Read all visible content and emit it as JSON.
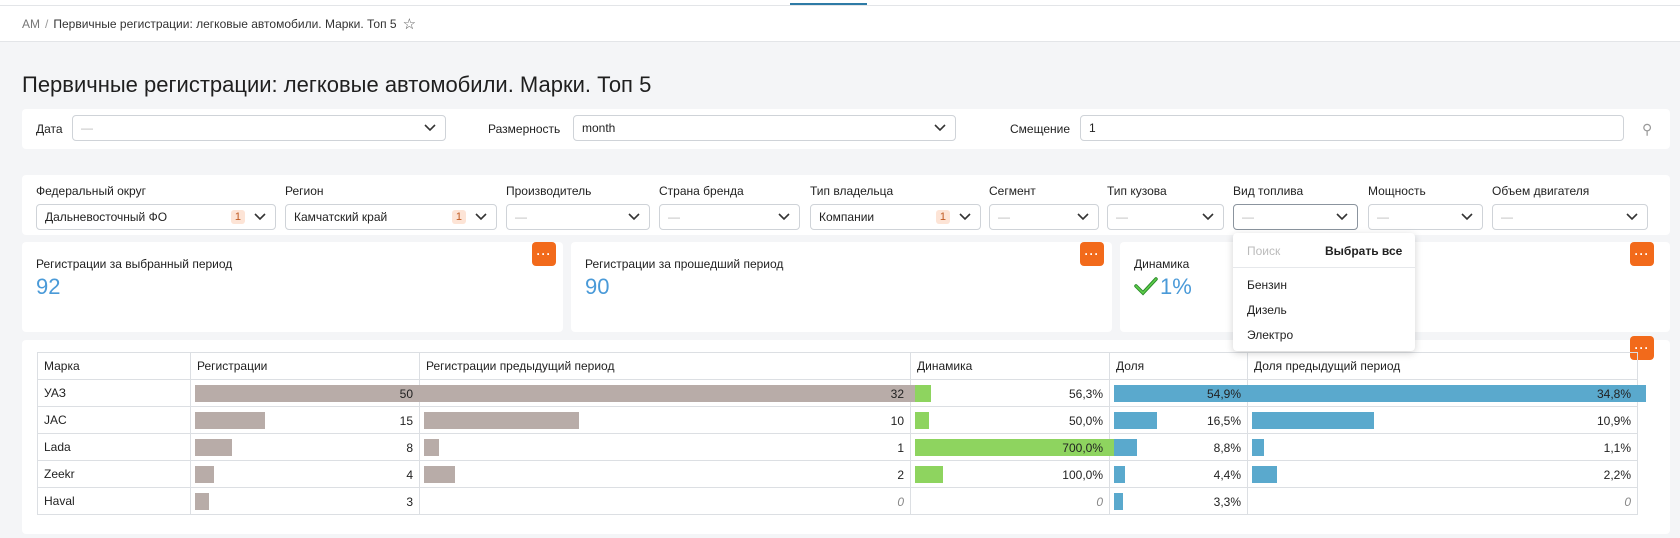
{
  "breadcrumb": {
    "root": "AM",
    "sep": "/",
    "current": "Первичные регистрации: легковые автомобили. Марки. Топ 5",
    "star": "☆"
  },
  "page_title": "Первичные регистрации: легковые автомобили. Марки. Топ 5",
  "filters_top": {
    "date_label": "Дата",
    "date_value": "—",
    "dim_label": "Размерность",
    "dim_value": "month",
    "offset_label": "Смещение",
    "offset_value": "1",
    "pin": "⚲"
  },
  "filters": {
    "fed_label": "Федеральный округ",
    "fed_value": "Дальневосточный ФО",
    "fed_count": "1",
    "region_label": "Регион",
    "region_value": "Камчатский край",
    "region_count": "1",
    "maker_label": "Производитель",
    "maker_value": "—",
    "country_label": "Страна бренда",
    "country_value": "—",
    "owner_label": "Тип владельца",
    "owner_value": "Компании",
    "owner_count": "1",
    "segment_label": "Сегмент",
    "segment_value": "—",
    "body_label": "Тип кузова",
    "body_value": "—",
    "fuel_label": "Вид топлива",
    "fuel_value": "—",
    "power_label": "Мощность",
    "power_value": "—",
    "engine_label": "Объем двигателя",
    "engine_value": "—"
  },
  "fuel_dropdown": {
    "search_placeholder": "Поиск",
    "select_all": "Выбрать все",
    "options": [
      "Бензин",
      "Дизель",
      "Электро"
    ]
  },
  "kpis": [
    {
      "title": "Регистрации за выбранный период",
      "value": "92"
    },
    {
      "title": "Регистрации за прошедший период",
      "value": "90"
    },
    {
      "title": "Динамика",
      "value": "1%"
    }
  ],
  "more_label": "···",
  "table": {
    "headers": [
      "Марка",
      "Регистрации",
      "Регистрации предыдущий период",
      "Динамика",
      "Доля",
      "Доля предыдущий период"
    ],
    "rows": [
      {
        "brand": "УАЗ",
        "reg": "50",
        "reg_prev": "32",
        "dyn": "56,3%",
        "share": "54,9%",
        "share_prev": "34,8%",
        "reg_f": 1.0,
        "regp_f": 1.0,
        "dyn_f": 0.08,
        "share_f": 1.0,
        "sharep_f": 1.0
      },
      {
        "brand": "JAC",
        "reg": "15",
        "reg_prev": "10",
        "dyn": "50,0%",
        "share": "16,5%",
        "share_prev": "10,9%",
        "reg_f": 0.3,
        "regp_f": 0.3125,
        "dyn_f": 0.07,
        "share_f": 0.3,
        "sharep_f": 0.31
      },
      {
        "brand": "Lada",
        "reg": "8",
        "reg_prev": "1",
        "dyn": "700,0%",
        "share": "8,8%",
        "share_prev": "1,1%",
        "reg_f": 0.16,
        "regp_f": 0.03,
        "dyn_f": 1.0,
        "share_f": 0.16,
        "sharep_f": 0.03
      },
      {
        "brand": "Zeekr",
        "reg": "4",
        "reg_prev": "2",
        "dyn": "100,0%",
        "share": "4,4%",
        "share_prev": "2,2%",
        "reg_f": 0.08,
        "regp_f": 0.0625,
        "dyn_f": 0.14,
        "share_f": 0.08,
        "sharep_f": 0.063
      },
      {
        "brand": "Haval",
        "reg": "3",
        "reg_prev": "0",
        "dyn": "0",
        "share": "3,3%",
        "share_prev": "0",
        "reg_f": 0.06,
        "regp_f": 0,
        "dyn_f": 0,
        "share_f": 0.06,
        "sharep_f": 0
      }
    ]
  },
  "colors": {
    "accent_orange": "#f26a1b",
    "kpi_blue": "#4a9ad8",
    "bar_reg": "#b8aca8",
    "bar_dyn": "#8ed45f",
    "bar_share": "#5aa9cd"
  }
}
